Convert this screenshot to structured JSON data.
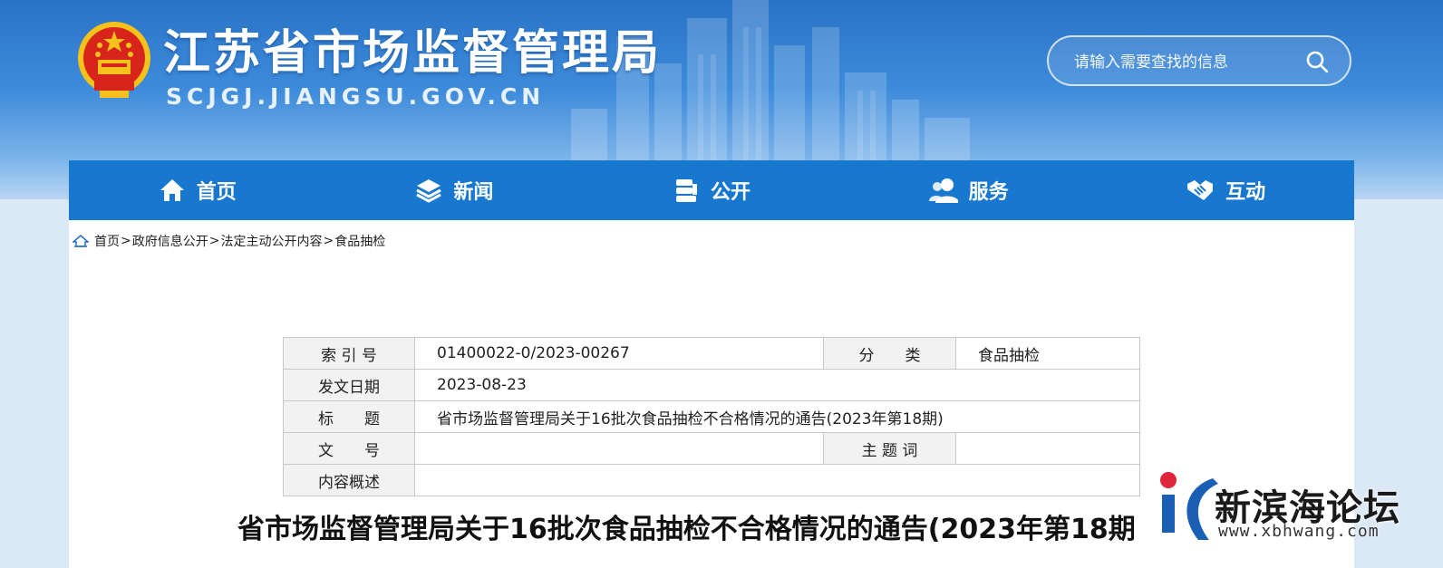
{
  "header": {
    "title": "江苏省市场监督管理局",
    "domain": "SCJGJ.JIANGSU.GOV.CN",
    "emblem": "national-emblem"
  },
  "search": {
    "placeholder": "请输入需要查找的信息",
    "icon": "search-icon"
  },
  "nav": {
    "items": [
      {
        "label": "首页",
        "icon": "home-icon"
      },
      {
        "label": "新闻",
        "icon": "layers-icon"
      },
      {
        "label": "公开",
        "icon": "document-stack-icon"
      },
      {
        "label": "服务",
        "icon": "users-icon"
      },
      {
        "label": "互动",
        "icon": "handshake-icon"
      }
    ]
  },
  "breadcrumb": {
    "items": [
      "首页",
      "政府信息公开",
      "法定主动公开内容",
      "食品抽检"
    ],
    "separator": ">"
  },
  "meta": {
    "index_label": "索 引 号",
    "index_value": "01400022-0/2023-00267",
    "category_label": "分　　类",
    "category_value": "食品抽检",
    "date_label": "发文日期",
    "date_value": "2023-08-23",
    "title_label": "标　　题",
    "title_value": "省市场监督管理局关于16批次食品抽检不合格情况的通告(2023年第18期)",
    "docno_label": "文　　号",
    "docno_value": "",
    "keywords_label": "主 题 词",
    "keywords_value": "",
    "summary_label": "内容概述",
    "summary_value": ""
  },
  "article": {
    "title": "省市场监督管理局关于16批次食品抽检不合格情况的通告(2023年第18期"
  },
  "watermark": {
    "name": "新滨海论坛",
    "url": "www.xbhwang.com"
  },
  "colors": {
    "nav_bg": "#1878cf",
    "banner_top": "#2a73c6",
    "table_border": "#c9c9c9",
    "table_label_bg": "#f2f2f2"
  }
}
